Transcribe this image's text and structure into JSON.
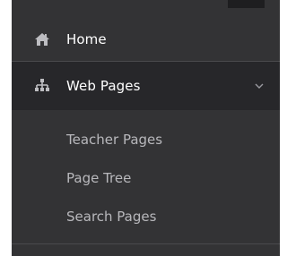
{
  "sidebar": {
    "items": [
      {
        "label": "Home",
        "icon": "home-icon"
      },
      {
        "label": "Web Pages",
        "icon": "sitemap-icon",
        "expanded": true,
        "children": [
          {
            "label": "Teacher Pages"
          },
          {
            "label": "Page Tree"
          },
          {
            "label": "Search Pages"
          }
        ]
      }
    ]
  },
  "colors": {
    "sidebar_bg": "#333335",
    "active_bg": "#27272a",
    "text_primary": "#ffffff",
    "text_secondary": "#b8b8bc"
  }
}
